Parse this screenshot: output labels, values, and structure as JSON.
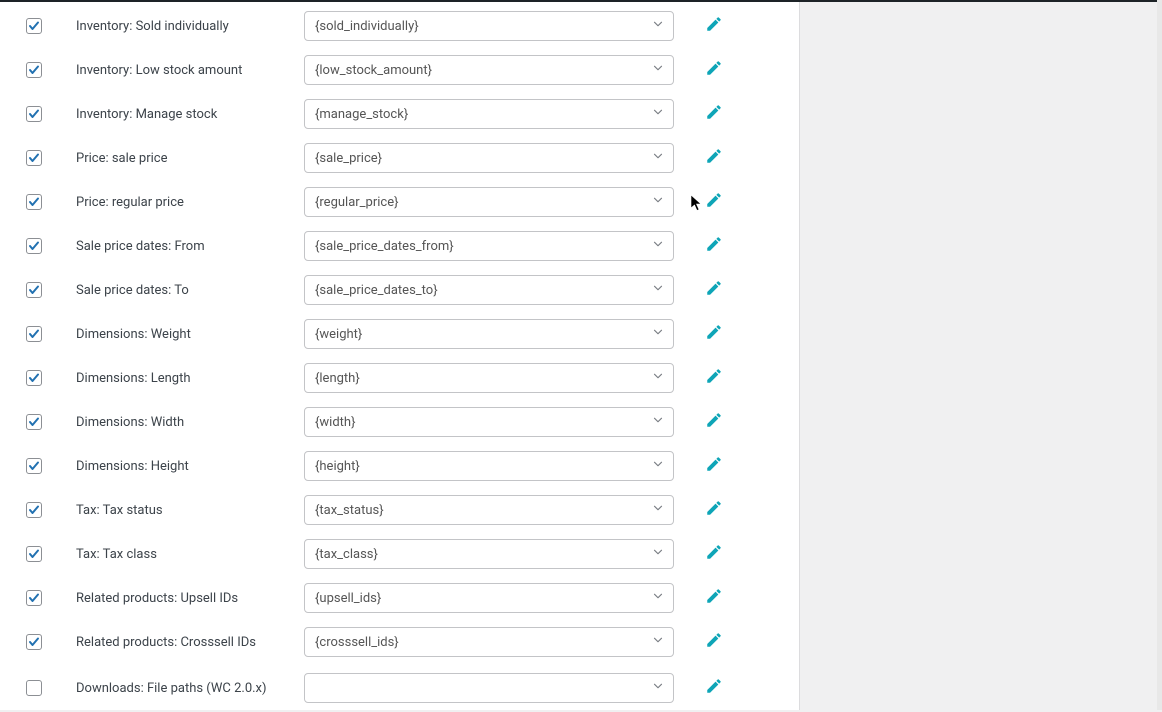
{
  "rows": [
    {
      "checked": true,
      "label": "Inventory: Sold individually",
      "value": "{sold_individually}"
    },
    {
      "checked": true,
      "label": "Inventory: Low stock amount",
      "value": "{low_stock_amount}"
    },
    {
      "checked": true,
      "label": "Inventory: Manage stock",
      "value": "{manage_stock}"
    },
    {
      "checked": true,
      "label": "Price: sale price",
      "value": "{sale_price}"
    },
    {
      "checked": true,
      "label": "Price: regular price",
      "value": "{regular_price}"
    },
    {
      "checked": true,
      "label": "Sale price dates: From",
      "value": "{sale_price_dates_from}"
    },
    {
      "checked": true,
      "label": "Sale price dates: To",
      "value": "{sale_price_dates_to}"
    },
    {
      "checked": true,
      "label": "Dimensions: Weight",
      "value": "{weight}"
    },
    {
      "checked": true,
      "label": "Dimensions: Length",
      "value": "{length}"
    },
    {
      "checked": true,
      "label": "Dimensions: Width",
      "value": "{width}"
    },
    {
      "checked": true,
      "label": "Dimensions: Height",
      "value": "{height}"
    },
    {
      "checked": true,
      "label": "Tax: Tax status",
      "value": "{tax_status}"
    },
    {
      "checked": true,
      "label": "Tax: Tax class",
      "value": "{tax_class}"
    },
    {
      "checked": true,
      "label": "Related products: Upsell IDs",
      "value": "{upsell_ids}"
    },
    {
      "checked": true,
      "label": "Related products: Crosssell IDs",
      "value": "{crosssell_ids}"
    },
    {
      "checked": false,
      "label": "Downloads: File paths (WC 2.0.x)",
      "value": ""
    }
  ],
  "colors": {
    "accent": "#2271b1",
    "editIcon": "#0ea5b7"
  }
}
